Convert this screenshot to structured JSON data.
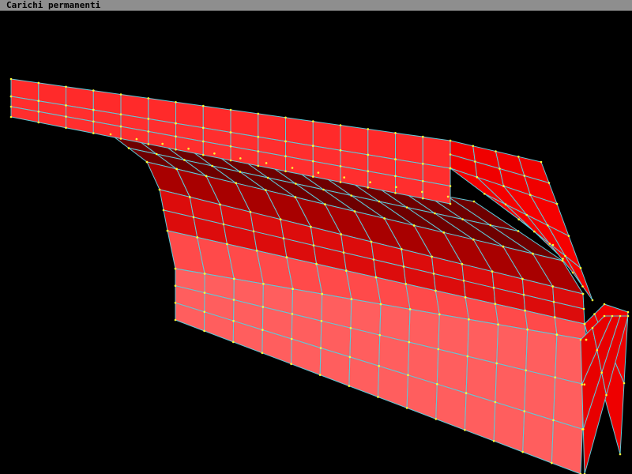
{
  "window": {
    "title": "Carichi permanenti"
  },
  "render": {
    "colors": {
      "background": "#000000",
      "edge": "#5fc9d8",
      "node": "#ffff33",
      "face_top": "#ff2e2e",
      "face_front": "#ff5e5e",
      "face_inner": "#b00000",
      "face_side": "#ee0000"
    }
  }
}
